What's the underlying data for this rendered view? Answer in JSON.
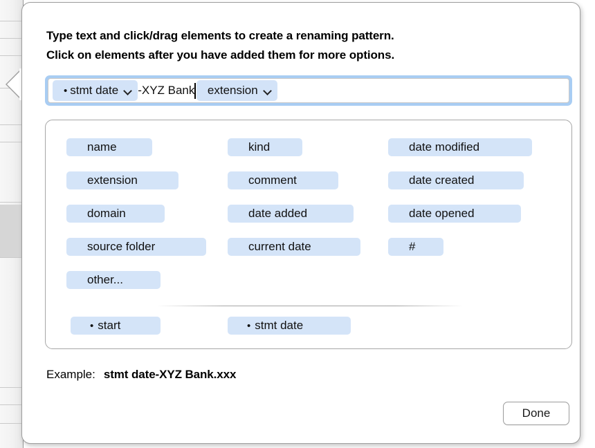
{
  "dialog": {
    "instructions": [
      "Type text and click/drag elements to create a renaming pattern.",
      "Click on elements after you have added them for more options."
    ],
    "pattern_field": {
      "tokens": [
        {
          "label": "stmt date",
          "bullet": "•",
          "chevron": "chevron-down-icon"
        }
      ],
      "literal_text": "-XYZ Bank",
      "trailing_token": {
        "label": "extension",
        "chevron": "chevron-down-icon"
      },
      "caret_visible": true,
      "focus_ring_color": "#a9cdf3"
    },
    "token_palette": {
      "chip_color": "#d4e4f8",
      "columns": [
        [
          "name",
          "extension",
          "domain",
          "source folder",
          "other..."
        ],
        [
          "kind",
          "comment",
          "date added",
          "current date"
        ],
        [
          "date modified",
          "date created",
          "date opened",
          "#"
        ]
      ],
      "saved_patterns": [
        {
          "label": "start",
          "bullet": "•"
        },
        {
          "label": "stmt date",
          "bullet": "•"
        }
      ]
    },
    "example": {
      "label": "Example:",
      "value": "stmt date-XYZ Bank.xxx"
    },
    "done_label": "Done"
  },
  "background_window": {
    "truncated_label": ":",
    "row_line_offsets": [
      30,
      55,
      80,
      127,
      180,
      205,
      292,
      372,
      560,
      585,
      612
    ],
    "selected_band_color": "#d6d6d6"
  }
}
